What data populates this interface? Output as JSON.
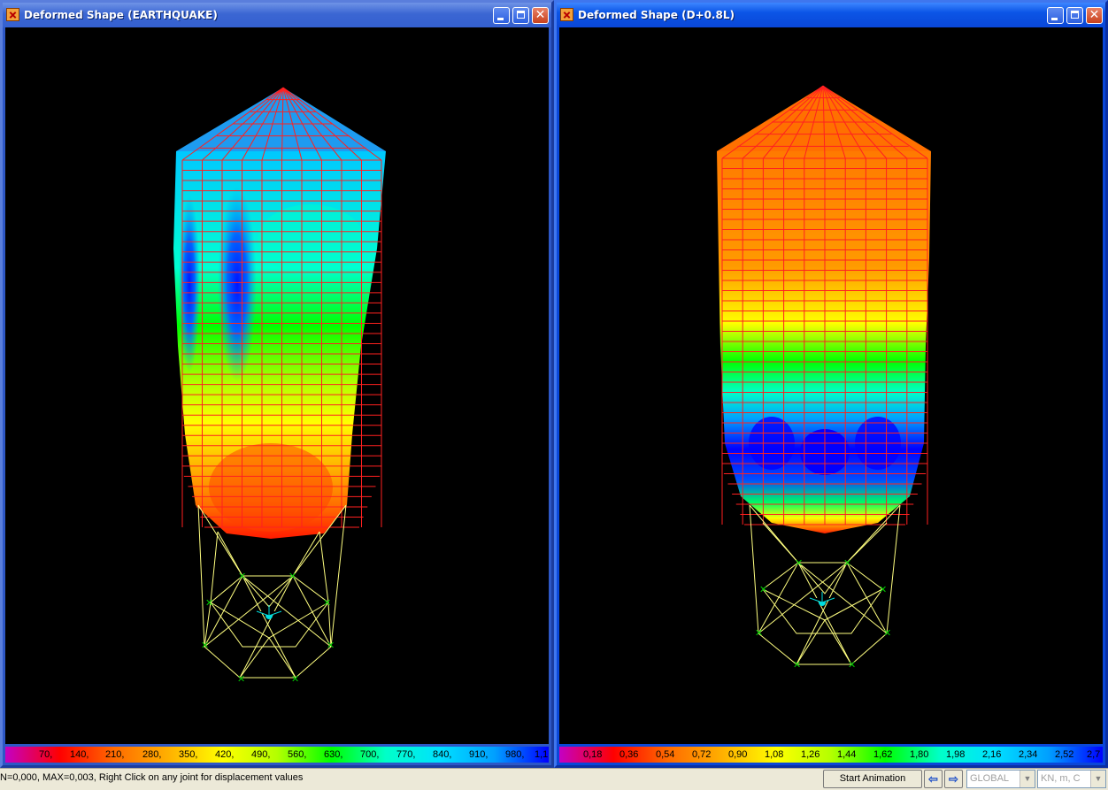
{
  "windows": [
    {
      "title": "Deformed Shape (EARTHQUAKE)",
      "legend": [
        "70,",
        "140,",
        "210,",
        "280,",
        "350,",
        "420,",
        "490,",
        "560,",
        "630,",
        "700,",
        "770,",
        "840,",
        "910,",
        "980,",
        "1,1"
      ]
    },
    {
      "title": "Deformed Shape (D+0.8L)",
      "legend": [
        "0,18",
        "0,36",
        "0,54",
        "0,72",
        "0,90",
        "1,08",
        "1,26",
        "1,44",
        "1,62",
        "1,80",
        "1,98",
        "2,16",
        "2,34",
        "2,52",
        "2,7"
      ]
    }
  ],
  "status": {
    "message": "N=0,000, MAX=0,003, Right Click on any joint for displacement values",
    "animation_button": "Start Animation",
    "coord_system": "GLOBAL",
    "units": "KN, m, C"
  },
  "icons": {
    "app": "sap2000-app-icon",
    "minimize": "minimize-icon",
    "maximize": "maximize-icon",
    "close": "close-icon",
    "prev": "arrow-left-icon",
    "next": "arrow-right-icon"
  },
  "colors": {
    "contour_scale": [
      "#c400c4",
      "#ff0000",
      "#ff6a00",
      "#ffb000",
      "#ffff00",
      "#b4ff00",
      "#00ff00",
      "#00ffc8",
      "#00e1ff",
      "#00a0ff",
      "#0000ff"
    ],
    "mesh_lines": "#ff2020",
    "frame_lines": "#ffff80",
    "support_markers": "#00c800"
  }
}
